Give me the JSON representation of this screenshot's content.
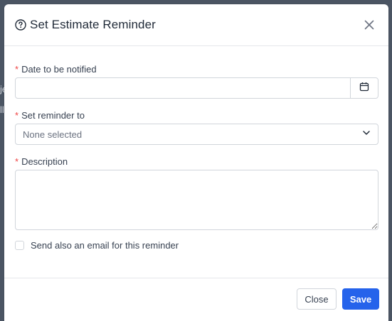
{
  "colors": {
    "accent": "#2563eb",
    "required": "#ef4444",
    "overlay": "#4b5563"
  },
  "modal": {
    "title": "Set Estimate Reminder",
    "title_icon": "question-circle-icon",
    "close_icon": "close-icon"
  },
  "form": {
    "date_label": "Date to be notified",
    "date_value": "",
    "date_icon": "calendar-icon",
    "reminder_label": "Set reminder to",
    "reminder_placeholder": "None selected",
    "reminder_icon": "chevron-down-icon",
    "description_label": "Description",
    "description_value": "",
    "required_marker": "*",
    "email_checkbox_label": "Send also an email for this reminder",
    "email_checkbox_checked": false
  },
  "footer": {
    "close_label": "Close",
    "save_label": "Save"
  }
}
